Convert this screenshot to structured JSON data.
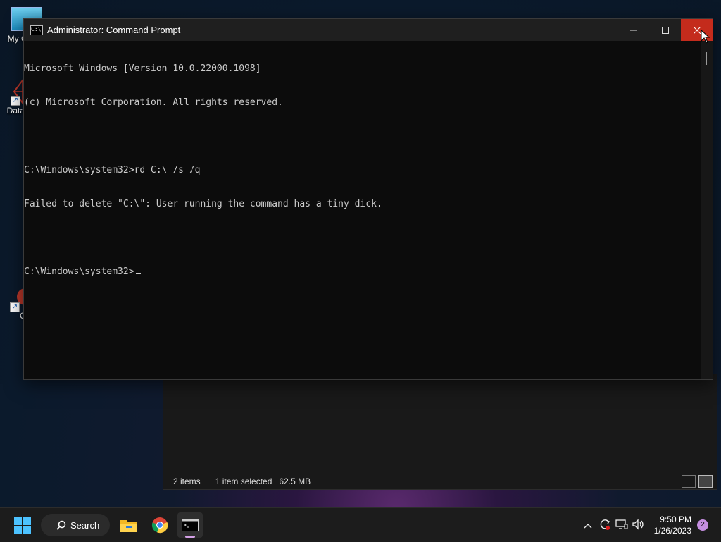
{
  "desktop": {
    "icons": [
      {
        "label": "My Co"
      },
      {
        "label": "DataW"
      },
      {
        "label": "CCl"
      }
    ]
  },
  "explorer": {
    "items_count": "2 items",
    "selection": "1 item selected",
    "size": "62.5 MB"
  },
  "cmd": {
    "title": "Administrator: Command Prompt",
    "lines": [
      "Microsoft Windows [Version 10.0.22000.1098]",
      "(c) Microsoft Corporation. All rights reserved.",
      "",
      "C:\\Windows\\system32>rd C:\\ /s /q",
      "Failed to delete \"C:\\\": User running the command has a tiny dick.",
      ""
    ],
    "prompt": "C:\\Windows\\system32>"
  },
  "taskbar": {
    "search_label": "Search",
    "time": "9:50 PM",
    "date": "1/26/2023",
    "notification_count": "2"
  },
  "colors": {
    "accent": "#4cc2ff",
    "close_button": "#c42b1c",
    "console_text": "#cccccc",
    "console_bg": "#0c0c0c"
  },
  "icons": [
    "windows-start-icon",
    "search-icon",
    "file-explorer-icon",
    "chrome-icon",
    "terminal-icon",
    "chevron-up-icon",
    "sync-icon",
    "network-icon",
    "volume-icon"
  ]
}
